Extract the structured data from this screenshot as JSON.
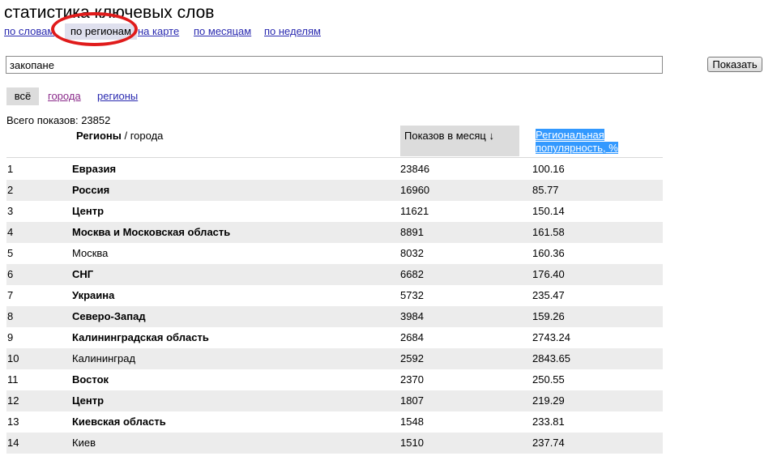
{
  "title": "статистика ключевых слов",
  "nav": {
    "by_words": "по словам",
    "by_regions": "по регионам",
    "on_map": "на карте",
    "by_months": "по месяцам",
    "by_weeks": "по неделям"
  },
  "search": {
    "value": "закопане",
    "button": "Показать"
  },
  "filter": {
    "all": "всё",
    "cities": "города",
    "regions": "регионы"
  },
  "total": "Всего показов: 23852",
  "table": {
    "col_regions": "Регионы",
    "col_cities": " / города",
    "col_shows": "Показов в месяц ↓",
    "col_popularity": "Региональная популярность, %",
    "rows": [
      {
        "n": "1",
        "name": "Евразия",
        "shows": "23846",
        "pop": "100.16",
        "bold": true
      },
      {
        "n": "2",
        "name": "Россия",
        "shows": "16960",
        "pop": "85.77",
        "bold": true
      },
      {
        "n": "3",
        "name": "Центр",
        "shows": "11621",
        "pop": "150.14",
        "bold": true
      },
      {
        "n": "4",
        "name": "Москва и Московская область",
        "shows": "8891",
        "pop": "161.58",
        "bold": true
      },
      {
        "n": "5",
        "name": "Москва",
        "shows": "8032",
        "pop": "160.36",
        "bold": false
      },
      {
        "n": "6",
        "name": "СНГ",
        "shows": "6682",
        "pop": "176.40",
        "bold": true
      },
      {
        "n": "7",
        "name": "Украина",
        "shows": "5732",
        "pop": "235.47",
        "bold": true
      },
      {
        "n": "8",
        "name": "Северо-Запад",
        "shows": "3984",
        "pop": "159.26",
        "bold": true
      },
      {
        "n": "9",
        "name": "Калининградская область",
        "shows": "2684",
        "pop": "2743.24",
        "bold": true
      },
      {
        "n": "10",
        "name": "Калининград",
        "shows": "2592",
        "pop": "2843.65",
        "bold": false
      },
      {
        "n": "11",
        "name": "Восток",
        "shows": "2370",
        "pop": "250.55",
        "bold": true
      },
      {
        "n": "12",
        "name": "Центр",
        "shows": "1807",
        "pop": "219.29",
        "bold": true
      },
      {
        "n": "13",
        "name": "Киевская область",
        "shows": "1548",
        "pop": "233.81",
        "bold": true
      },
      {
        "n": "14",
        "name": "Киев",
        "shows": "1510",
        "pop": "237.74",
        "bold": false
      }
    ]
  },
  "colors": {
    "link": "#2a2ab0",
    "visited_link": "#8a2a8a",
    "highlight": "#3399ff",
    "annotation": "#e01b1b"
  }
}
